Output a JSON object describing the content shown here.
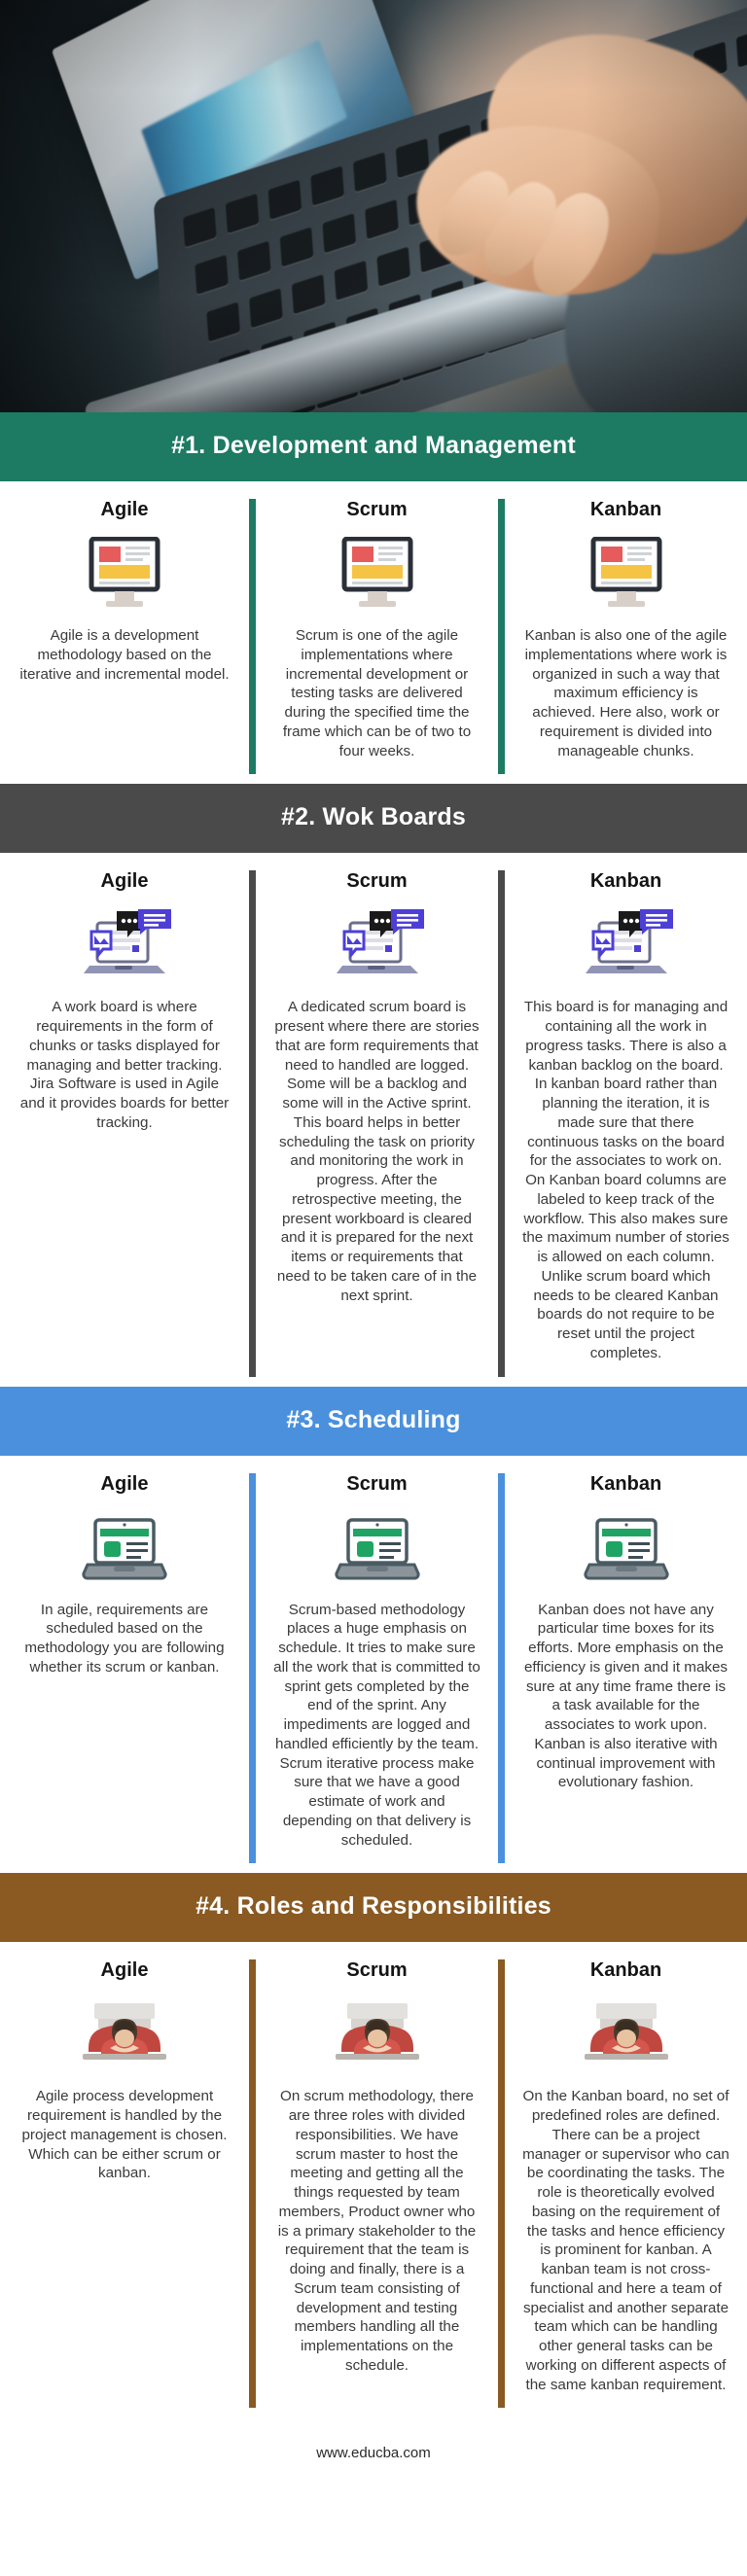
{
  "site": {
    "footer_url": "www.educba.com"
  },
  "hero": {
    "alt": "hands typing on a laptop keyboard"
  },
  "sections": [
    {
      "id": "development-and-management",
      "header": "#1. Development and Management",
      "header_bg": "#1d7a63",
      "divider_color": "#1d7a63",
      "icon": "monitor-icon",
      "columns": [
        {
          "title": "Agile",
          "text": "Agile is a development methodology based on the iterative and incremental model."
        },
        {
          "title": "Scrum",
          "text": "Scrum is one of the agile implementations where incremental development or testing tasks are delivered during the specified time the frame which can be of two to four weeks."
        },
        {
          "title": "Kanban",
          "text": "Kanban is also one of the agile implementations where work is organized in such a way that maximum efficiency is achieved. Here also, work or requirement is divided into manageable chunks."
        }
      ]
    },
    {
      "id": "wok-boards",
      "header": "#2. Wok Boards",
      "header_bg": "#4a4a4a",
      "divider_color": "#4a4a4a",
      "icon": "board-chat-icon",
      "columns": [
        {
          "title": "Agile",
          "text": "A work board is where requirements in the form of chunks or tasks displayed for managing and better tracking. Jira Software is used in Agile and it provides boards for better tracking."
        },
        {
          "title": "Scrum",
          "text": "A dedicated scrum board is present where there are stories that are form requirements that need to handled are logged. Some will be a backlog and some will in the Active sprint. This board helps in better scheduling the task on priority and monitoring the work in progress. After the retrospective meeting, the present workboard is cleared and it is prepared for the next items or requirements that need to be taken care of in the next sprint."
        },
        {
          "title": "Kanban",
          "text": "This board is for managing and containing all the work in progress tasks. There is also a kanban backlog on the board. In kanban board rather than planning the iteration, it is made sure that there continuous tasks on the board for the associates to work on. On Kanban board columns are labeled to keep track of the workflow. This also makes sure the maximum number of stories is allowed on each column. Unlike scrum board which needs to be cleared Kanban boards do not require to be reset until the project completes."
        }
      ]
    },
    {
      "id": "scheduling",
      "header": "#3. Scheduling",
      "header_bg": "#4a90dd",
      "divider_color": "#4a90dd",
      "icon": "laptop-icon",
      "columns": [
        {
          "title": "Agile",
          "text": "In agile, requirements are scheduled based on the methodology you are following whether its scrum or kanban."
        },
        {
          "title": "Scrum",
          "text": "Scrum-based methodology places a huge emphasis on schedule. It tries to make sure all the work that is committed to sprint gets completed by the end of the sprint. Any impediments are logged and handled efficiently by the team. Scrum iterative process make sure that we have a good estimate of work and depending on that delivery is scheduled."
        },
        {
          "title": "Kanban",
          "text": "Kanban does not have any particular time boxes for its efforts. More emphasis on the efficiency is given and it makes sure at any time frame there is a task available for the associates to work upon. Kanban is also iterative with continual improvement with evolutionary fashion."
        }
      ]
    },
    {
      "id": "roles-and-responsibilities",
      "header": "#4. Roles and Responsibilities",
      "header_bg": "#8a5a22",
      "divider_color": "#8a5a22",
      "icon": "people-icon",
      "columns": [
        {
          "title": "Agile",
          "text": "Agile process development requirement is handled by the project management is chosen. Which can be either scrum or kanban."
        },
        {
          "title": "Scrum",
          "text": "On scrum methodology, there are three roles with divided responsibilities. We have scrum master to host the meeting and getting all the things requested by team members, Product owner who is a primary stakeholder to the requirement that the team is doing and finally, there is a Scrum team consisting of development and testing members handling all the implementations on the schedule."
        },
        {
          "title": "Kanban",
          "text": "On the Kanban board, no set of predefined roles are defined. There can be a project manager or supervisor who can be coordinating the tasks. The role is theoretically evolved basing on the requirement of the tasks and hence efficiency is prominent for kanban. A kanban team is not cross-functional and here a team of specialist and another separate team which can be handling other general tasks can be working on different aspects of the same kanban requirement."
        }
      ]
    }
  ],
  "palette": {
    "teal": "#1d7a63",
    "gray": "#4a4a4a",
    "blue": "#4a90dd",
    "brown": "#8a5a22",
    "icon_red": "#e65b5b",
    "icon_yellow": "#f6c445",
    "icon_green": "#1fa463",
    "icon_purple": "#4d3fd6",
    "icon_dark": "#2b3038"
  }
}
